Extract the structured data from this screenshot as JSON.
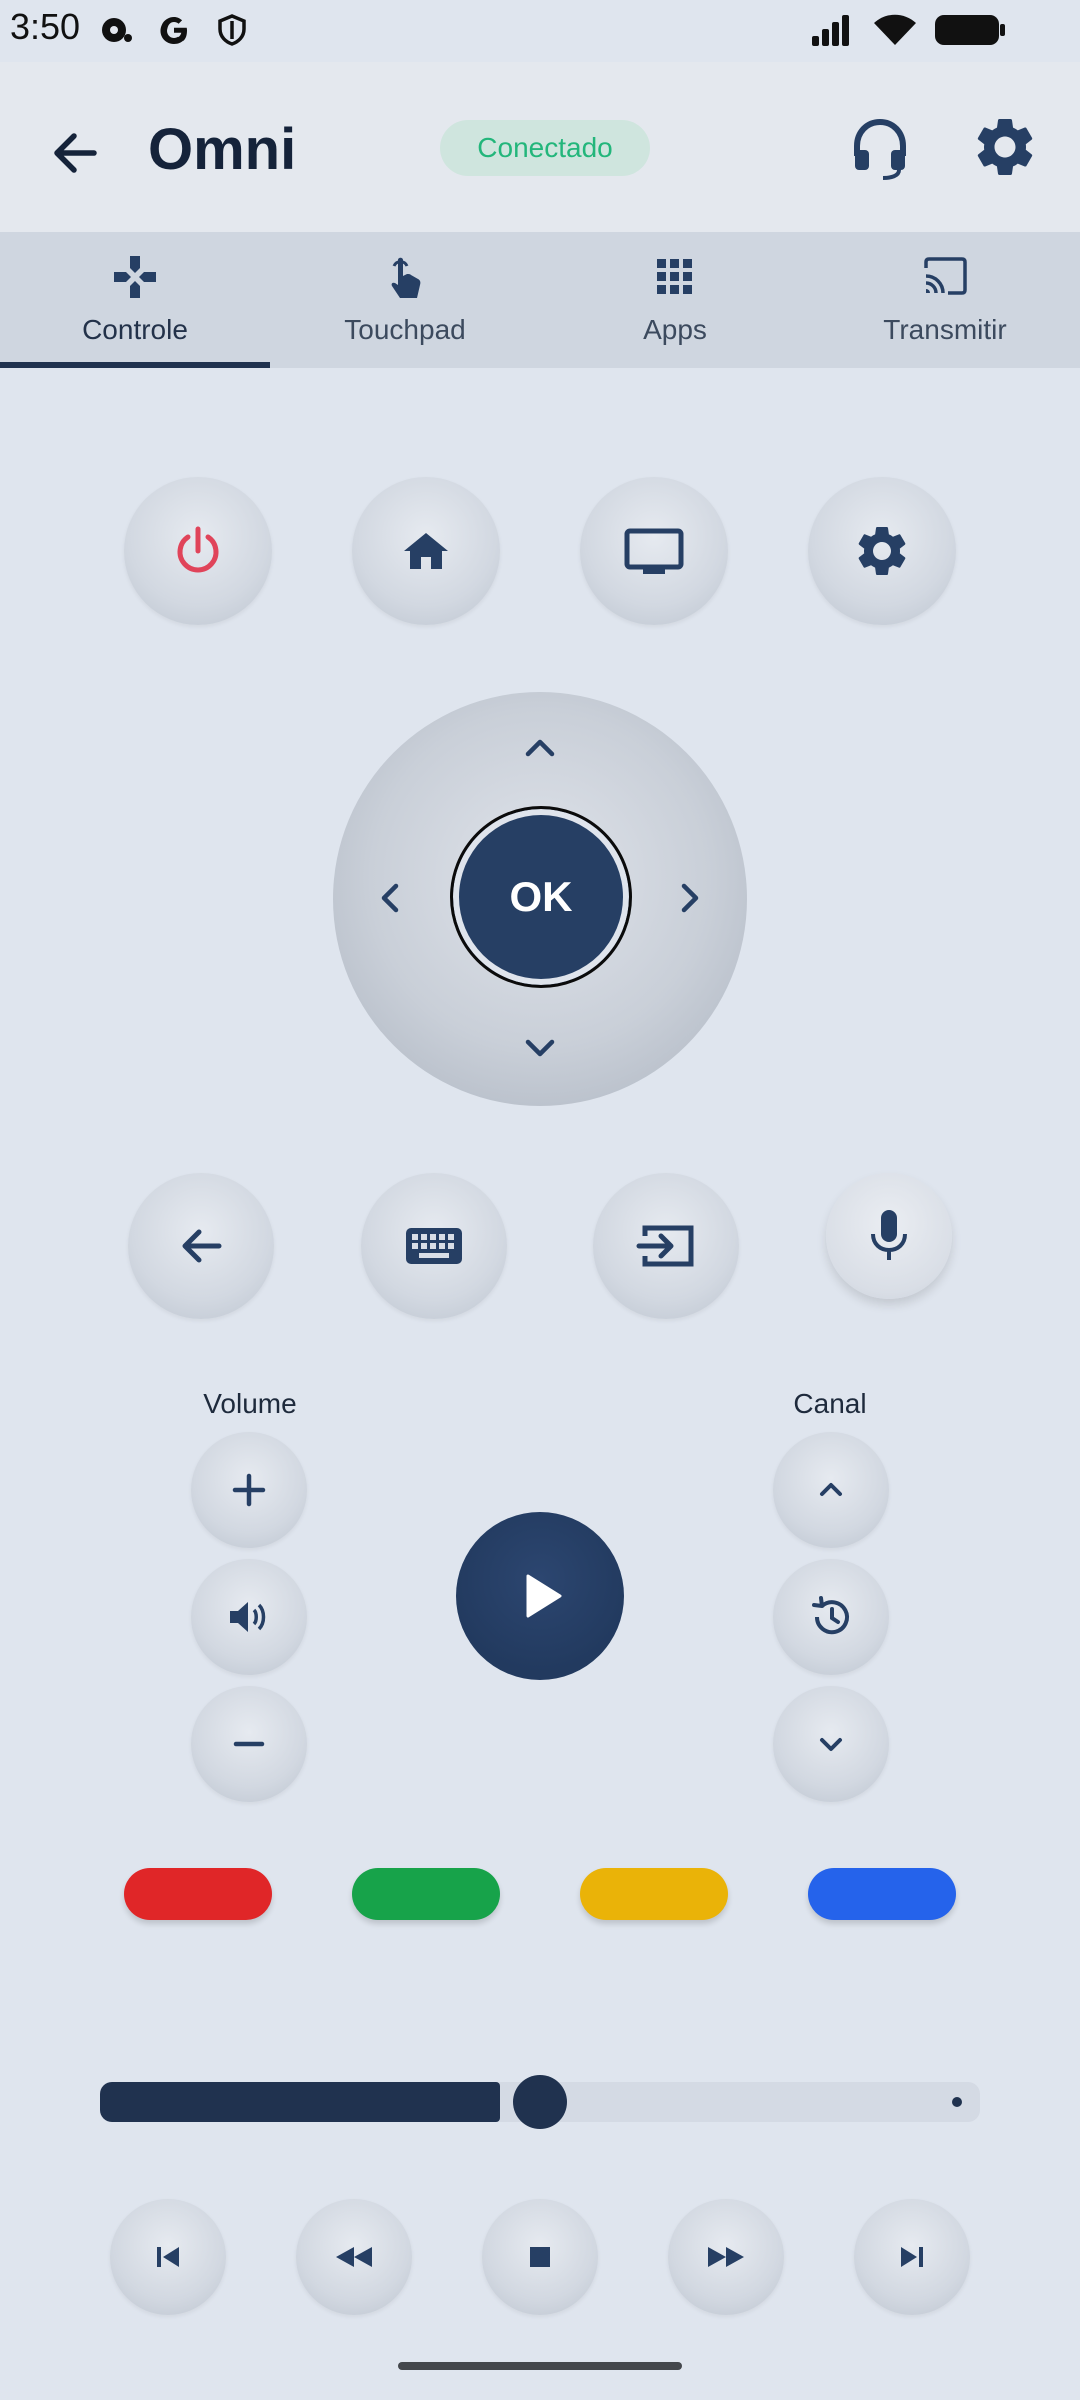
{
  "status_bar": {
    "time": "3:50"
  },
  "header": {
    "title": "Omni",
    "status": "Conectado"
  },
  "tabs": [
    {
      "label": "Controle",
      "icon": "gamepad-icon"
    },
    {
      "label": "Touchpad",
      "icon": "touch-icon"
    },
    {
      "label": "Apps",
      "icon": "apps-grid-icon"
    },
    {
      "label": "Transmitir",
      "icon": "cast-icon"
    }
  ],
  "active_tab": "Controle",
  "dpad": {
    "ok_label": "OK"
  },
  "volume": {
    "label": "Volume"
  },
  "channel": {
    "label": "Canal"
  },
  "color_buttons": [
    "#e02628",
    "#17a34a",
    "#eab308",
    "#2563eb"
  ],
  "colors": {
    "accent": "#20324f",
    "power": "#e0445a",
    "status_text": "#23b67b",
    "status_bg": "#cfe5de"
  },
  "seekbar": {
    "progress": 0.5
  }
}
